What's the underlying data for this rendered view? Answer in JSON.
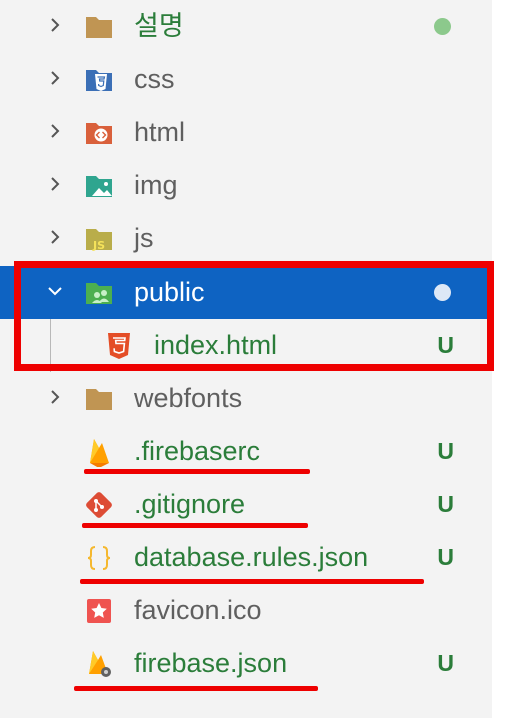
{
  "explorer": {
    "items": [
      {
        "label": "설명",
        "icon": "folder-icon",
        "status": "",
        "dot": "green"
      },
      {
        "label": "css",
        "icon": "css-folder-icon",
        "status": "",
        "dot": ""
      },
      {
        "label": "html",
        "icon": "html-folder-icon",
        "status": "",
        "dot": ""
      },
      {
        "label": "img",
        "icon": "images-folder-icon",
        "status": "",
        "dot": ""
      },
      {
        "label": "js",
        "icon": "js-folder-icon",
        "status": "",
        "dot": ""
      },
      {
        "label": "public",
        "icon": "public-folder-icon",
        "status": "",
        "dot": "white",
        "selected": true,
        "expanded": true
      },
      {
        "label": "index.html",
        "icon": "html5-file-icon",
        "status": "U",
        "child": true
      },
      {
        "label": "webfonts",
        "icon": "folder-icon",
        "status": ""
      },
      {
        "label": ".firebaserc",
        "icon": "firebase-icon",
        "status": "U"
      },
      {
        "label": ".gitignore",
        "icon": "git-icon",
        "status": "U"
      },
      {
        "label": "database.rules.json",
        "icon": "json-braces-icon",
        "status": "U"
      },
      {
        "label": "favicon.ico",
        "icon": "favicon-star-icon",
        "status": ""
      },
      {
        "label": "firebase.json",
        "icon": "firebase-json-icon",
        "status": "U"
      }
    ]
  },
  "colors": {
    "selected_bg": "#0e63c2",
    "tracked_green": "#2b7d3a",
    "annotation_red": "#ee0000",
    "folder_tan": "#c09553"
  }
}
